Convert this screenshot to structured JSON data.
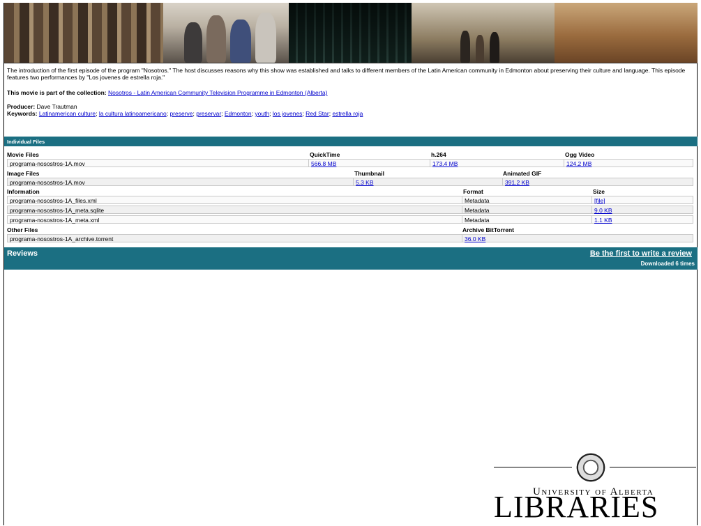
{
  "description": "The introduction of the first episode of the program \"Nosotros.\" The host discusses reasons why this show was established and talks to different members of the Latin American community in Edmonton about preserving their culture and language. This episode features two performances by \"Los jovenes de estrella roja.\"",
  "collection": {
    "label": "This movie is part of the collection:",
    "link": "Nosotros - Latin American Community Television Programme in Edmonton (Alberta)"
  },
  "producer": {
    "label": "Producer:",
    "value": "Dave Trautman"
  },
  "keywords": {
    "label": "Keywords:",
    "items": [
      "Latinamerican culture",
      "la cultura latinoamericano",
      "preserve",
      "preservar",
      "Edmonton",
      "youth",
      "los jovenes",
      "Red Star",
      "estrella roja"
    ]
  },
  "individual_files_title": "Individual Files",
  "movie_files": {
    "header": "Movie Files",
    "cols": [
      "QuickTime",
      "h.264",
      "Ogg Video"
    ],
    "name": "programa-nosostros-1A.mov",
    "values": [
      "566.8 MB",
      "173.4 MB",
      "124.2 MB"
    ]
  },
  "image_files": {
    "header": "Image Files",
    "cols": [
      "Thumbnail",
      "Animated GIF"
    ],
    "name": "programa-nosostros-1A.mov",
    "values": [
      "5.3 KB",
      "391.2 KB"
    ]
  },
  "information": {
    "header": "Information",
    "cols": [
      "Format",
      "Size"
    ],
    "rows": [
      {
        "name": "programa-nosostros-1A_files.xml",
        "format": "Metadata",
        "size": "[file]"
      },
      {
        "name": "programa-nosostros-1A_meta.sqlite",
        "format": "Metadata",
        "size": "9.0 KB"
      },
      {
        "name": "programa-nosostros-1A_meta.xml",
        "format": "Metadata",
        "size": "1.1 KB"
      }
    ]
  },
  "other_files": {
    "header": "Other Files",
    "cols": [
      "Archive BitTorrent"
    ],
    "name": "programa-nosostros-1A_archive.torrent",
    "values": [
      "36.0 KB"
    ]
  },
  "reviews": {
    "title": "Reviews",
    "write_link": "Be the first to write a review",
    "downloads": "Downloaded 6 times"
  },
  "logo": {
    "university": "University of Alberta",
    "libraries": "LIBRARIES"
  }
}
